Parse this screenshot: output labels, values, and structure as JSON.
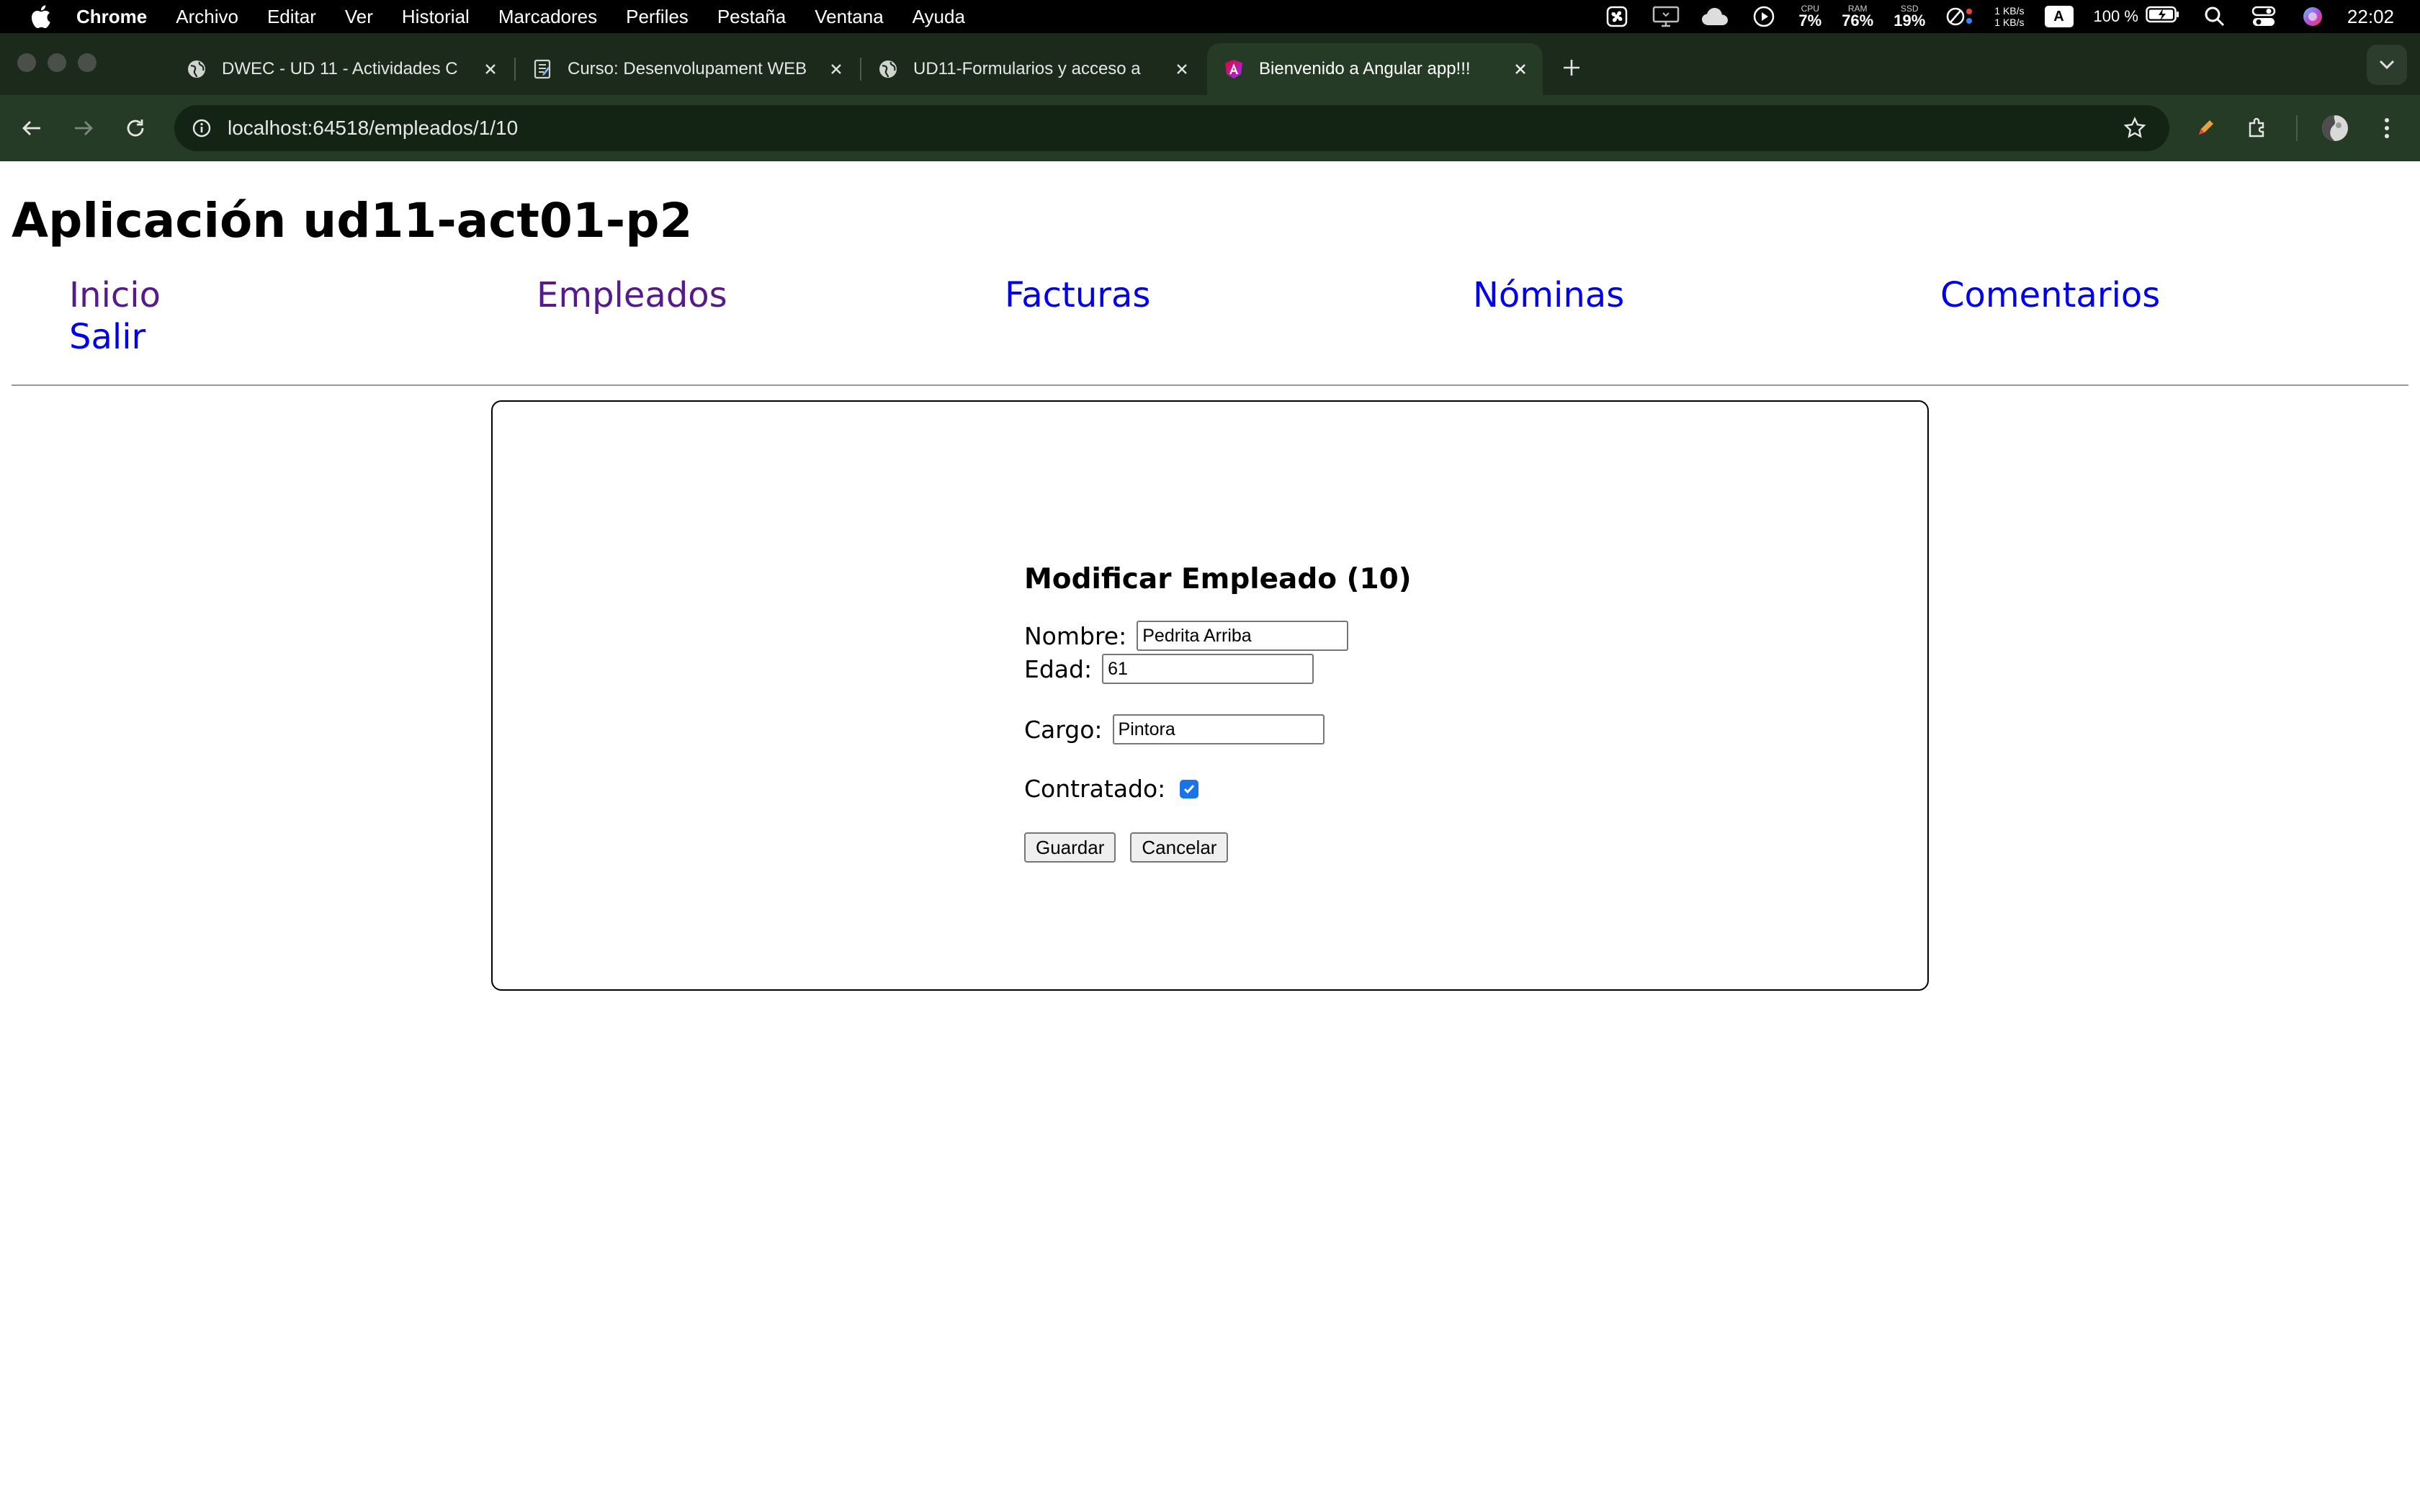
{
  "menubar": {
    "app_name": "Chrome",
    "menus": [
      "Archivo",
      "Editar",
      "Ver",
      "Historial",
      "Marcadores",
      "Perfiles",
      "Pestaña",
      "Ventana",
      "Ayuda"
    ],
    "status": {
      "cpu_label": "CPU",
      "cpu_value": "7%",
      "ram_label": "RAM",
      "ram_value": "76%",
      "ssd_label": "SSD",
      "ssd_value": "19%",
      "net_up": "1 KB/s",
      "net_down": "1 KB/s",
      "input_source": "A",
      "battery": "100 %",
      "time": "22:02"
    }
  },
  "browser": {
    "tabs": [
      {
        "title": "DWEC - UD 11 - Actividades C",
        "icon": "globe-icon",
        "active": false
      },
      {
        "title": "Curso: Desenvolupament WEB",
        "icon": "document-icon",
        "active": false
      },
      {
        "title": "UD11-Formularios y acceso a",
        "icon": "globe-icon",
        "active": false
      },
      {
        "title": "Bienvenido a Angular app!!!",
        "icon": "angular-icon",
        "active": true
      }
    ],
    "url": "localhost:64518/empleados/1/10"
  },
  "page": {
    "title": "Aplicación ud11-act01-p2",
    "nav": {
      "inicio": "Inicio",
      "empleados": "Empleados",
      "facturas": "Facturas",
      "nominas": "Nóminas",
      "comentarios": "Comentarios",
      "salir": "Salir"
    },
    "form": {
      "heading": "Modificar Empleado (10)",
      "nombre_label": "Nombre:",
      "nombre_value": "Pedrita Arriba",
      "edad_label": "Edad:",
      "edad_value": "61",
      "cargo_label": "Cargo:",
      "cargo_value": "Pintora",
      "contratado_label": "Contratado:",
      "contratado_checked": true,
      "guardar_label": "Guardar",
      "cancelar_label": "Cancelar"
    }
  },
  "colors": {
    "link_visited": "#551a8b",
    "link_unvisited": "#0000ee",
    "checkbox_accent": "#1a73e8",
    "chrome_frame": "#1c2a1c",
    "chrome_toolbar": "#263b26"
  }
}
